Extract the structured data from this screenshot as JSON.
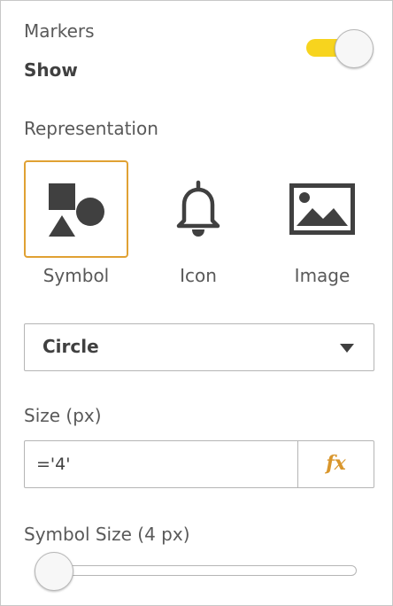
{
  "markers": {
    "label": "Markers",
    "toggle_text": "Show",
    "toggle_on": true,
    "toggle_color": "#f7d41e"
  },
  "representation": {
    "label": "Representation",
    "selected_color": "#e0a133",
    "options": [
      {
        "label": "Symbol",
        "icon": "shapes-icon",
        "selected": true
      },
      {
        "label": "Icon",
        "icon": "bell-icon",
        "selected": false
      },
      {
        "label": "Image",
        "icon": "image-icon",
        "selected": false
      }
    ]
  },
  "symbol_select": {
    "value": "Circle",
    "icon": "caret-down-icon"
  },
  "size": {
    "label": "Size (px)",
    "value": "='4'",
    "fx_label": "fx",
    "fx_color": "#d9962c"
  },
  "symbol_size": {
    "label": "Symbol Size (4 px)",
    "slider_fraction": 0.0
  }
}
